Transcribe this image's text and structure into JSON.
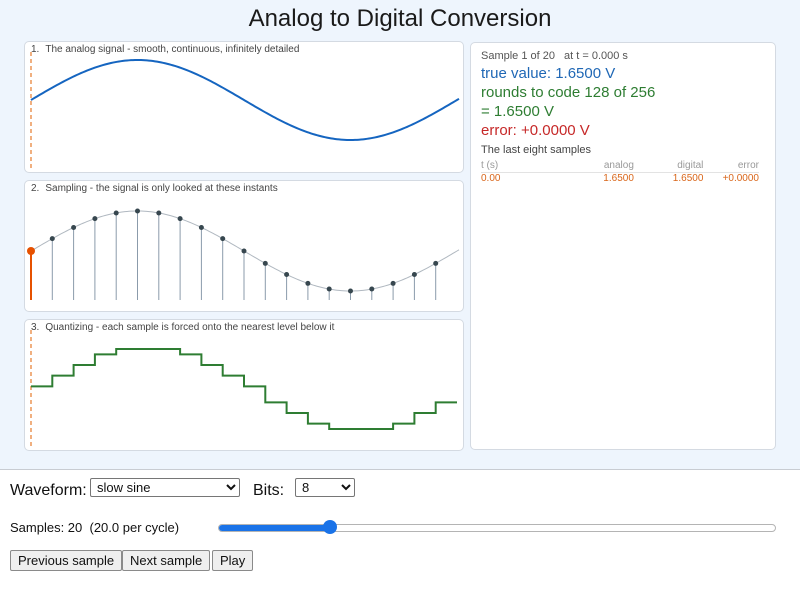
{
  "title": "Analog to Digital Conversion",
  "panels": {
    "analog": {
      "number": "1.",
      "label": "The analog signal - smooth, continuous, infinitely detailed"
    },
    "sampling": {
      "number": "2.",
      "label": "Sampling - the signal is only looked at these instants"
    },
    "quantizing": {
      "number": "3.",
      "label": "Quantizing - each sample is forced onto the nearest level below it"
    }
  },
  "info": {
    "sample_header": "Sample 1 of 20",
    "time_header": "at t = 0.000 s",
    "true_value": "true value: 1.6500 V",
    "rounds_to": "rounds to code 128 of 256",
    "equals": "= 1.6500 V",
    "error": "error: +0.0000 V",
    "last_samples_title": "The last eight samples",
    "table_headers": [
      "t (s)",
      "analog",
      "digital",
      "error"
    ],
    "table_rows": [
      [
        "0.00",
        "1.6500",
        "1.6500",
        "+0.0000"
      ]
    ]
  },
  "controls": {
    "waveform_label": "Waveform:",
    "waveform_value": "slow sine",
    "bits_label": "Bits:",
    "bits_value": "8",
    "samples_text": "Samples: 20  (20.0 per cycle)",
    "samples_value": 20,
    "samples_slider_fraction": 0.2,
    "prev_label": "Previous sample",
    "next_label": "Next sample",
    "play_label": "Play"
  },
  "signal": {
    "type": "sine",
    "samples_per_cycle": 20,
    "current_sample_index": 0,
    "quantize_levels_shown": 16,
    "colors": {
      "analog": "#1565c0",
      "sample_stem": "#8b9bab",
      "sample_dot": "#37474f",
      "current_sample": "#e65100",
      "time_marker": "#e8843c",
      "quantized": "#2e7d32",
      "trace": "#b0b8c0"
    }
  },
  "colors": {
    "background": "#eef5fd",
    "true_value": "#1f67b5",
    "rounded_code": "#2e7d32",
    "error": "#c62828",
    "table_values": "#d9661a"
  }
}
